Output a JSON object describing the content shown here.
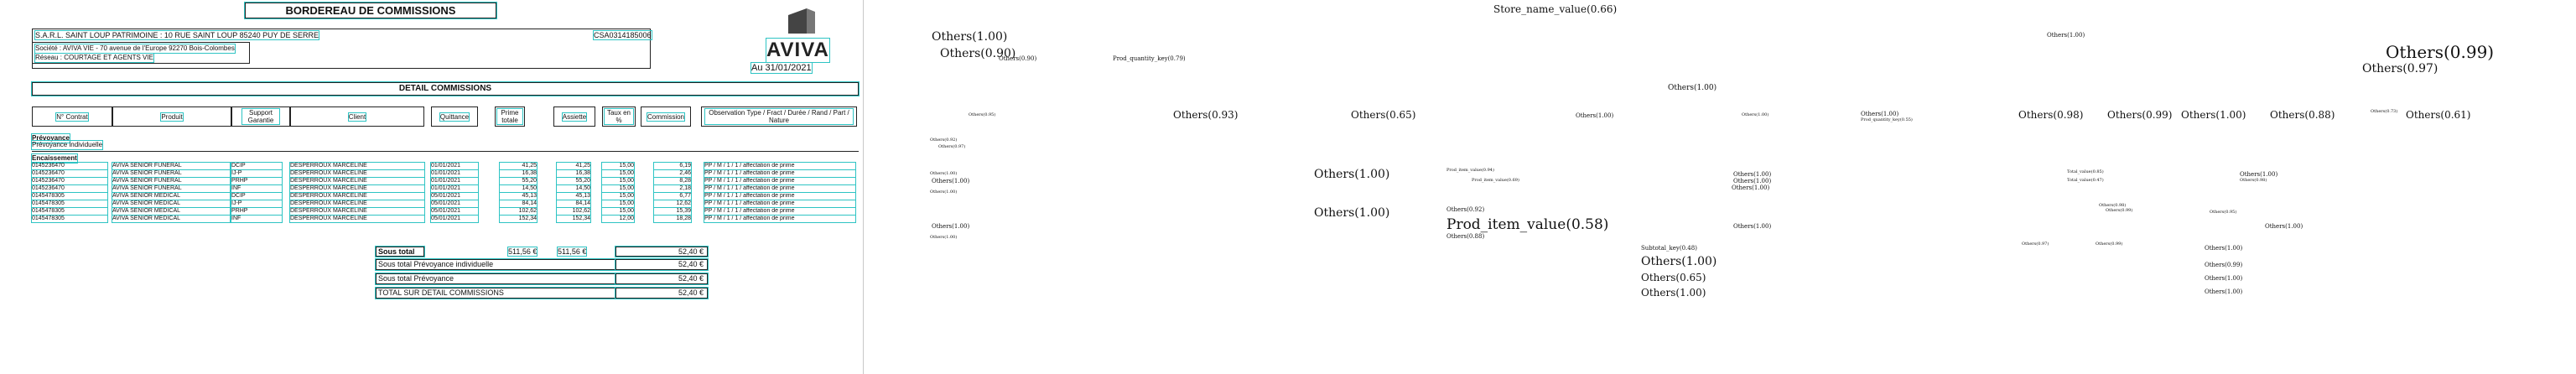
{
  "document": {
    "title": "BORDEREAU DE COMMISSIONS",
    "broker_line": "S.A.R.L. SAINT LOUP PATRIMOINE : 10 RUE SAINT LOUP  85240 PUY DE SERRE",
    "broker_code": "CSA0314185006",
    "company_line": "Société : AVIVA VIE - 70 avenue de l'Europe 92270 Bois-Colombes",
    "network_line": "Réseau : COURTAGE ET AGENTS VIE",
    "logo_text": "AVIVA",
    "date": "Au 31/01/2021",
    "detail_title": "DETAIL COMMISSIONS",
    "columns": [
      "N° Contrat",
      "Produit",
      "Support Garantie",
      "Client",
      "Quittance",
      "Prime totale",
      "Assiette",
      "Taux en %",
      "Commission",
      "Observation Type / Fract / Durée / Rand / Part / Nature"
    ],
    "section_label": "Prévoyance",
    "section_sub": "Prévoyance individuelle",
    "group_label": "Encaissement",
    "rows": [
      [
        "0145236470",
        "AVIVA SENIOR FUNERAL",
        "DCIP",
        "DESPERROUX MARCELINE",
        "01/01/2021",
        "41,25",
        "41,25",
        "15,00",
        "6,19",
        "PP / M / 1 / 1 / affectation de prime"
      ],
      [
        "0145236470",
        "AVIVA SENIOR FUNERAL",
        "IJ-P",
        "DESPERROUX MARCELINE",
        "01/01/2021",
        "16,38",
        "16,38",
        "15,00",
        "2,46",
        "PP / M / 1 / 1 / affectation de prime"
      ],
      [
        "0145236470",
        "AVIVA SENIOR FUNERAL",
        "PRHP",
        "DESPERROUX MARCELINE",
        "01/01/2021",
        "55,20",
        "55,20",
        "15,00",
        "8,28",
        "PP / M / 1 / 1 / affectation de prime"
      ],
      [
        "0145236470",
        "AVIVA SENIOR FUNERAL",
        "INF",
        "DESPERROUX MARCELINE",
        "01/01/2021",
        "14,50",
        "14,50",
        "15,00",
        "2,18",
        "PP / M / 1 / 1 / affectation de prime"
      ],
      [
        "0145478305",
        "AVIVA SENIOR MEDICAL",
        "DCIP",
        "DESPERROUX MARCELINE",
        "05/01/2021",
        "45,13",
        "45,13",
        "15,00",
        "6,77",
        "PP / M / 1 / 1 / affectation de prime"
      ],
      [
        "0145478305",
        "AVIVA SENIOR MEDICAL",
        "IJ-P",
        "DESPERROUX MARCELINE",
        "05/01/2021",
        "84,14",
        "84,14",
        "15,00",
        "12,62",
        "PP / M / 1 / 1 / affectation de prime"
      ],
      [
        "0145478305",
        "AVIVA SENIOR MEDICAL",
        "PRHP",
        "DESPERROUX MARCELINE",
        "05/01/2021",
        "102,62",
        "102,62",
        "15,00",
        "15,39",
        "PP / M / 1 / 1 / affectation de prime"
      ],
      [
        "0145478305",
        "AVIVA SENIOR MEDICAL",
        "INF",
        "DESPERROUX MARCELINE",
        "05/01/2021",
        "152,34",
        "152,34",
        "12,00",
        "18,28",
        "PP / M / 1 / 1 / affectation de prime"
      ]
    ],
    "total_row": {
      "label": "Sous total",
      "prime": "511,56 €",
      "assiette": "511,56 €",
      "commission": "52,40 €"
    },
    "subtotals": [
      {
        "label": "Sous total Prévoyance individuelle",
        "value": "52,40 €"
      },
      {
        "label": "Sous total Prévoyance",
        "value": "52,40 €"
      },
      {
        "label": "TOTAL SUR DETAIL COMMISSIONS",
        "value": "52,40 €"
      }
    ]
  },
  "labels": [
    {
      "text": "Store_name_value(0.66)",
      "size": "s4"
    },
    {
      "text": "Others(1.00)",
      "size": "s5"
    },
    {
      "text": "Others(0.90)",
      "size": "s5"
    },
    {
      "text": "Others(0.90)",
      "size": "s2"
    },
    {
      "text": "Prod_quantity_key(0.79)",
      "size": "s2"
    },
    {
      "text": "Others(1.00)",
      "size": "s2"
    },
    {
      "text": "Others(0.99)",
      "size": "s7"
    },
    {
      "text": "Others(0.97)",
      "size": "s5"
    },
    {
      "text": "Others(1.00)",
      "size": "s3"
    },
    {
      "text": "Others(0.95)",
      "size": "s1"
    },
    {
      "text": "Others(0.93)",
      "size": "s4"
    },
    {
      "text": "Others(0.65)",
      "size": "s4"
    },
    {
      "text": "Others(1.00)",
      "size": "s2"
    },
    {
      "text": "Others(1.00)",
      "size": "s1"
    },
    {
      "text": "Others(1.00)",
      "size": "s2"
    },
    {
      "text": "Prod_quantity_key(0.55)",
      "size": "s1"
    },
    {
      "text": "Others(0.98)",
      "size": "s4"
    },
    {
      "text": "Others(0.99)",
      "size": "s4"
    },
    {
      "text": "Others(1.00)",
      "size": "s4"
    },
    {
      "text": "Others(0.88)",
      "size": "s4"
    },
    {
      "text": "Others(0.73)",
      "size": "s1"
    },
    {
      "text": "Others(0.61)",
      "size": "s4"
    },
    {
      "text": "Others(0.92)",
      "size": "s1"
    },
    {
      "text": "Others(0.97)",
      "size": "s1"
    },
    {
      "text": "Others(1.00)",
      "size": "s5"
    },
    {
      "text": "Others(1.00)",
      "size": "s5"
    },
    {
      "text": "Prod_item_value(0.94)",
      "size": "s1"
    },
    {
      "text": "Prod_item_value(0.69)",
      "size": "s1"
    },
    {
      "text": "Others(0.92)",
      "size": "s2"
    },
    {
      "text": "Prod_item_value(0.58)",
      "size": "s6"
    },
    {
      "text": "Others(0.88)",
      "size": "s2"
    },
    {
      "text": "Subtotal_key(0.48)",
      "size": "s2"
    },
    {
      "text": "Others(1.00)",
      "size": "s5"
    },
    {
      "text": "Others(0.65)",
      "size": "s4"
    },
    {
      "text": "Others(1.00)",
      "size": "s4"
    },
    {
      "text": "Others(1.00)",
      "size": "s1"
    },
    {
      "text": "Others(1.00)",
      "size": "s1"
    },
    {
      "text": "Others(1.00)",
      "size": "s1"
    },
    {
      "text": "Others(1.00)",
      "size": "s2"
    },
    {
      "text": "Others(1.00)",
      "size": "s2"
    },
    {
      "text": "Others(1.00)",
      "size": "s2"
    },
    {
      "text": "Total_value(0.85)",
      "size": "s1"
    },
    {
      "text": "Total_value(0.47)",
      "size": "s1"
    },
    {
      "text": "Others(0.98)",
      "size": "s1"
    },
    {
      "text": "Others(0.99)",
      "size": "s1"
    },
    {
      "text": "Others(0.95)",
      "size": "s1"
    },
    {
      "text": "Others(1.00)",
      "size": "s2"
    },
    {
      "text": "Others(1.00)",
      "size": "s2"
    },
    {
      "text": "Others(1.00)",
      "size": "s2"
    },
    {
      "text": "Others(1.00)",
      "size": "s2"
    },
    {
      "text": "Others(0.98)",
      "size": "s1"
    },
    {
      "text": "Others(0.97)",
      "size": "s1"
    },
    {
      "text": "Others(0.99)",
      "size": "s1"
    },
    {
      "text": "Others(1.00)",
      "size": "s2"
    },
    {
      "text": "Others(0.99)",
      "size": "s2"
    },
    {
      "text": "Others(1.00)",
      "size": "s2"
    },
    {
      "text": "Others(1.00)",
      "size": "s2"
    },
    {
      "text": "Others(1.00)",
      "size": "s2"
    }
  ]
}
